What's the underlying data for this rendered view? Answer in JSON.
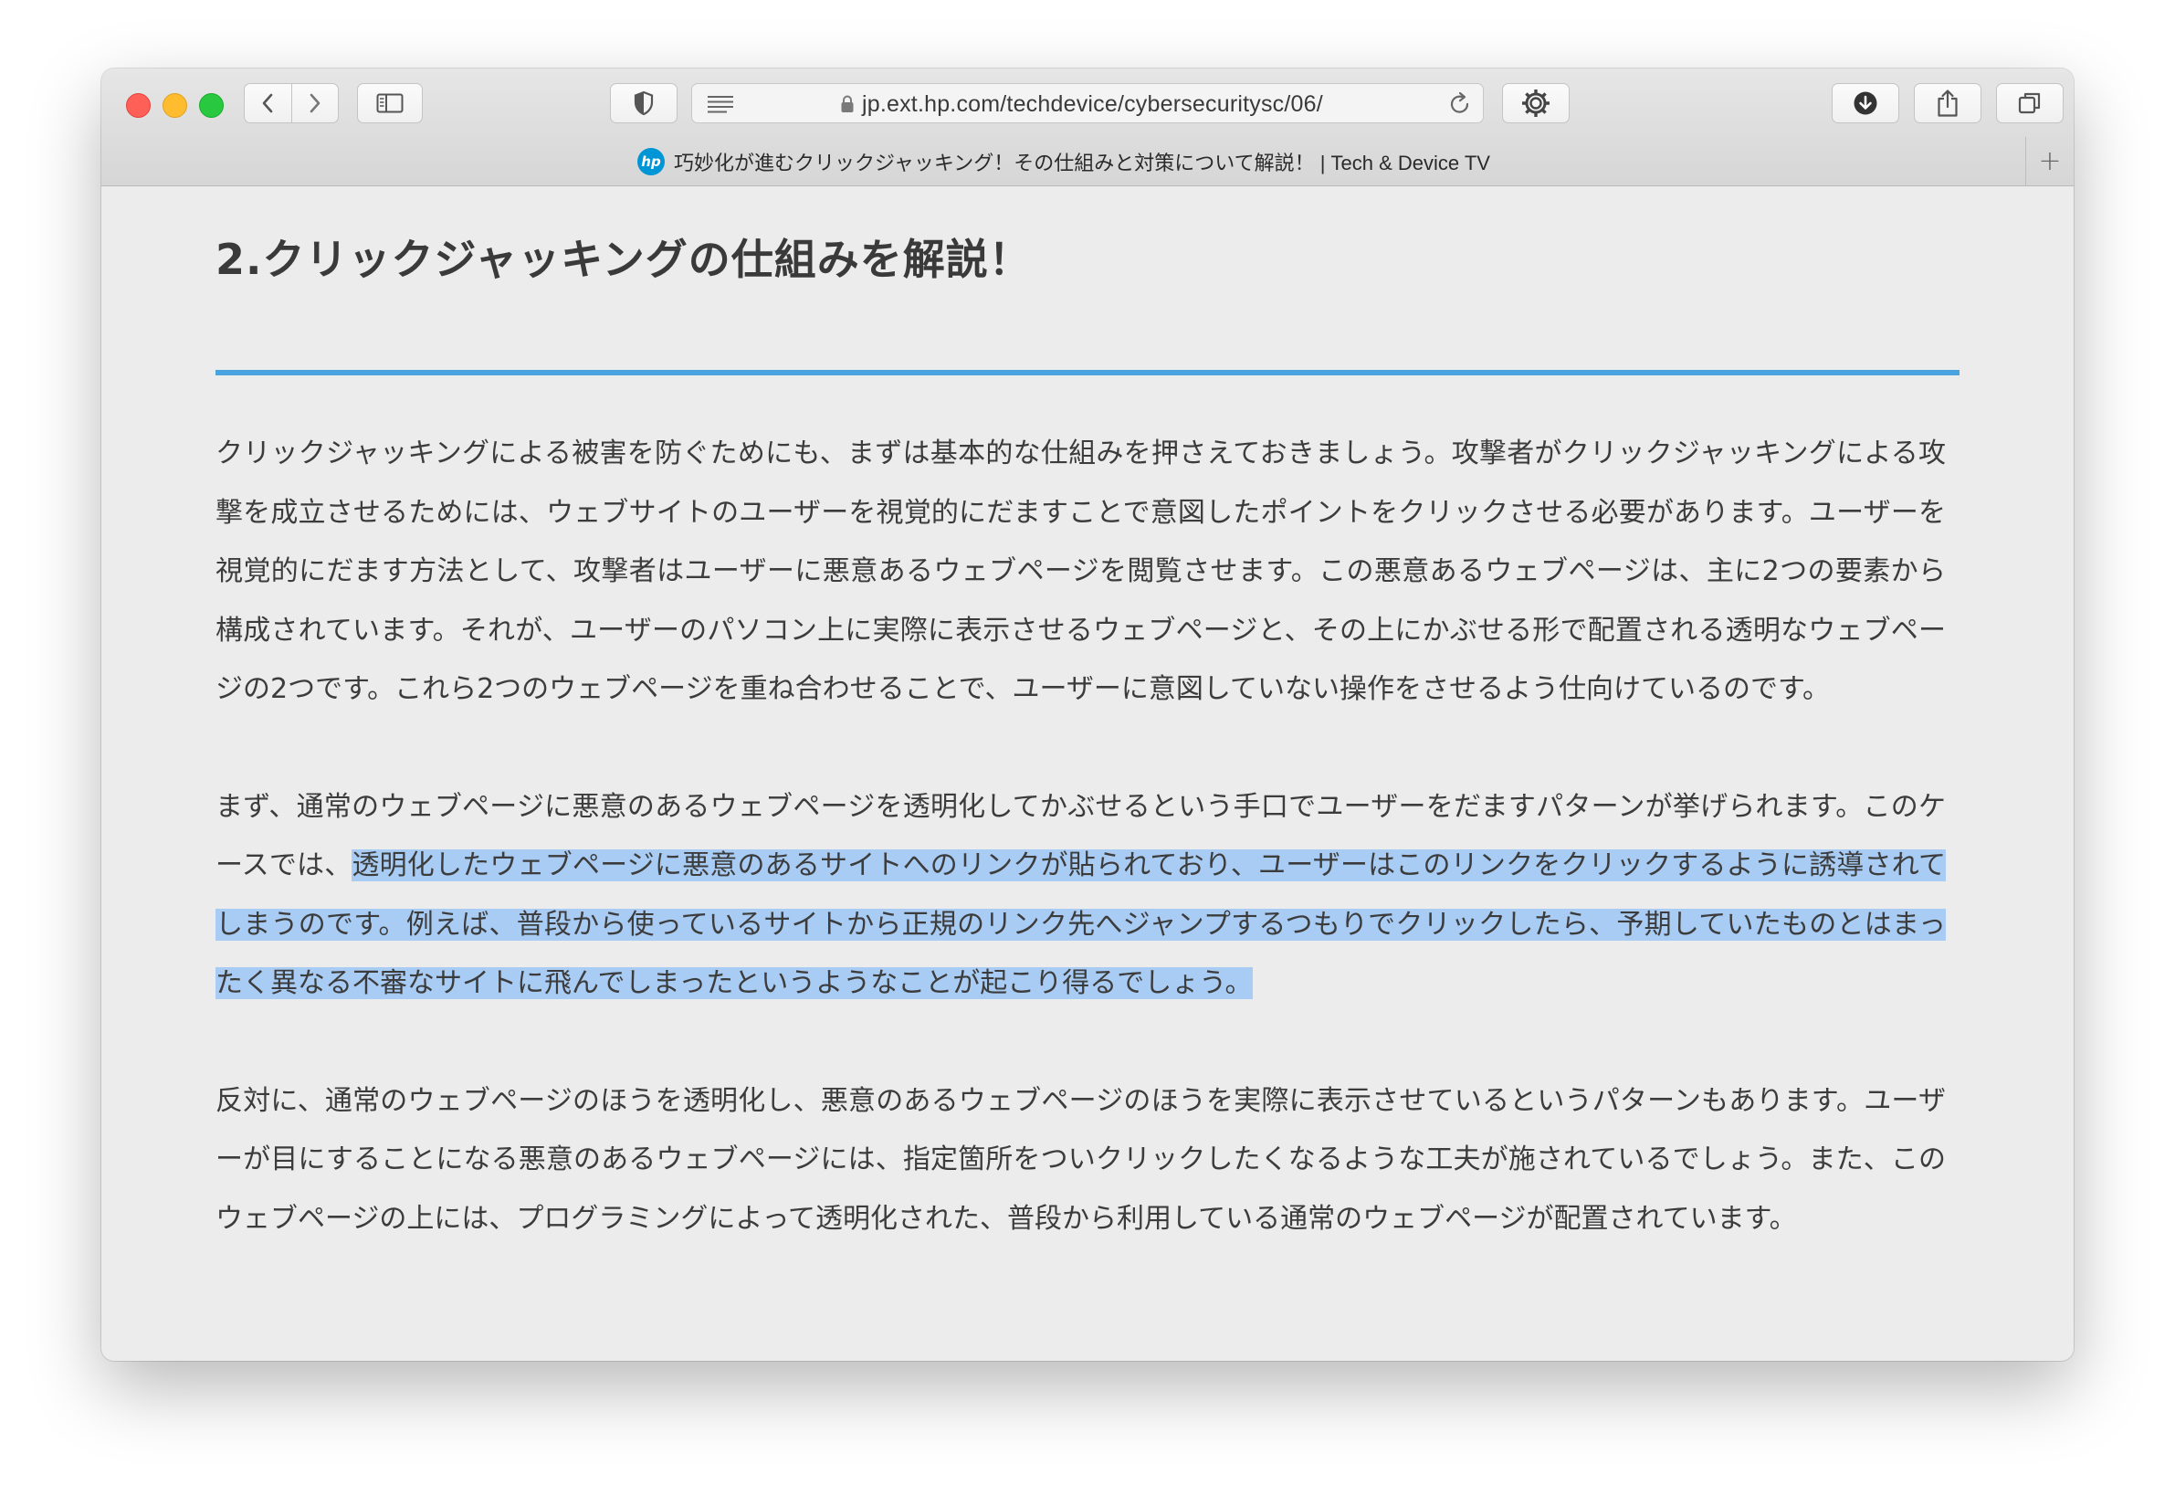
{
  "window": {
    "url": "jp.ext.hp.com/techdevice/cybersecuritysc/06/",
    "tab_title": "巧妙化が進むクリックジャッキング！その仕組みと対策について解説！ | Tech & Device TV",
    "favicon_text": "hp",
    "new_tab_label": "+"
  },
  "icons": {
    "back": "chevron-left-icon",
    "forward": "chevron-right-icon",
    "sidebar": "sidebar-icon",
    "shield": "privacy-shield-icon",
    "reader": "reader-icon",
    "lock": "lock-icon",
    "reload": "reload-icon",
    "extension": "gear-icon",
    "download": "download-icon",
    "share": "share-icon",
    "tabs": "tab-overview-icon"
  },
  "article": {
    "heading": "2.クリックジャッキングの仕組みを解説！",
    "paragraphs": [
      {
        "text": "クリックジャッキングによる被害を防ぐためにも、まずは基本的な仕組みを押さえておきましょう。攻撃者がクリックジャッキングによる攻撃を成立させるためには、ウェブサイトのユーザーを視覚的にだますことで意図したポイントをクリックさせる必要があります。ユーザーを視覚的にだます方法として、攻撃者はユーザーに悪意あるウェブページを閲覧させます。この悪意あるウェブページは、主に2つの要素から構成されています。それが、ユーザーのパソコン上に実際に表示させるウェブページと、その上にかぶせる形で配置される透明なウェブページの2つです。これら2つのウェブページを重ね合わせることで、ユーザーに意図していない操作をさせるよう仕向けているのです。"
      },
      {
        "text_before": "まず、通常のウェブページに悪意のあるウェブページを透明化してかぶせるという手口でユーザーをだますパターンが挙げられます。このケースでは、",
        "text_selected": "透明化したウェブページに悪意のあるサイトへのリンクが貼られており、ユーザーはこのリンクをクリックするように誘導されてしまうのです。例えば、普段から使っているサイトから正規のリンク先へジャンプするつもりでクリックしたら、予期していたものとはまったく異なる不審なサイトに飛んでしまったというようなことが起こり得るでしょう。"
      },
      {
        "text": "反対に、通常のウェブページのほうを透明化し、悪意のあるウェブページのほうを実際に表示させているというパターンもあります。ユーザーが目にすることになる悪意のあるウェブページには、指定箇所をついクリックしたくなるような工夫が施されているでしょう。また、このウェブページの上には、プログラミングによって透明化された、普段から利用している通常のウェブページが配置されています。"
      }
    ]
  },
  "colors": {
    "accent_rule": "#4aa3de",
    "selection": "#a9ccf4",
    "text": "#3c3c3c"
  }
}
